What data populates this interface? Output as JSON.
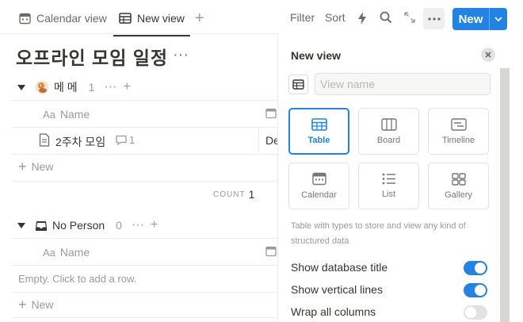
{
  "tabs": [
    {
      "label": "Calendar view",
      "icon": "calendar-icon",
      "active": false
    },
    {
      "label": "New view",
      "icon": "table-icon",
      "active": true
    }
  ],
  "toolbar": {
    "filter_label": "Filter",
    "sort_label": "Sort",
    "new_label": "New",
    "accent": "#2383e2"
  },
  "page": {
    "title": "오프라인 모임 일정",
    "title_more": "···"
  },
  "groups": [
    {
      "name": "메 메",
      "count": "1",
      "column_prefix": "Aa",
      "column_name": "Name",
      "rows": [
        {
          "name": "2주차 모임",
          "comments": "1",
          "next_cell": "De"
        }
      ],
      "new_label": "New",
      "calc_label": "COUNT",
      "calc_value": "1"
    },
    {
      "name": "No Person",
      "count": "0",
      "column_prefix": "Aa",
      "column_name": "Name",
      "empty_text": "Empty. Click to add a row.",
      "new_label": "New"
    }
  ],
  "panel": {
    "title": "New view",
    "name_placeholder": "View name",
    "layouts": [
      {
        "label": "Table",
        "icon": "table-icon",
        "selected": true
      },
      {
        "label": "Board",
        "icon": "board-icon",
        "selected": false
      },
      {
        "label": "Timeline",
        "icon": "timeline-icon",
        "selected": false
      },
      {
        "label": "Calendar",
        "icon": "calendar-icon",
        "selected": false
      },
      {
        "label": "List",
        "icon": "list-icon",
        "selected": false
      },
      {
        "label": "Gallery",
        "icon": "gallery-icon",
        "selected": false
      }
    ],
    "description": "Table with types to store and view any kind of structured data",
    "options": [
      {
        "label": "Show database title",
        "on": true
      },
      {
        "label": "Show vertical lines",
        "on": true
      },
      {
        "label": "Wrap all columns",
        "on": false
      }
    ]
  }
}
